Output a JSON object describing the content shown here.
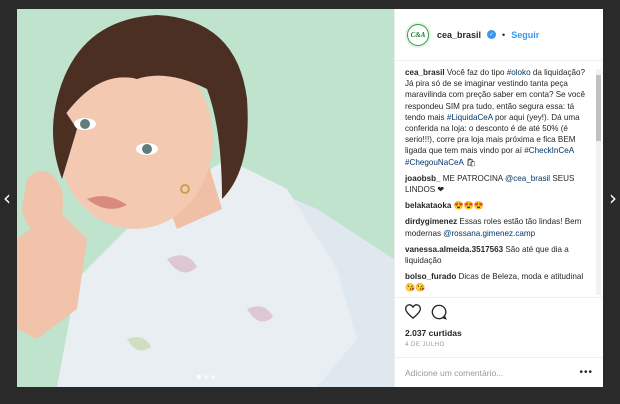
{
  "nav": {
    "prev_glyph": "‹",
    "next_glyph": "›"
  },
  "post": {
    "carousel": {
      "count": 3,
      "active": 1
    }
  },
  "header": {
    "avatar_text": "C&A",
    "username": "cea_brasil",
    "separator": "•",
    "follow_label": "Seguir"
  },
  "comments": [
    {
      "user": "cea_brasil",
      "parts": [
        {
          "t": " Você faz do tipo "
        },
        {
          "t": "#oloko",
          "tag": true
        },
        {
          "t": " da liquidação? Já pira só de se imaginar vestindo tanta peça maravilinda com preção saber em conta? Se você respondeu SIM pra tudo, então segura essa: tá tendo mais "
        },
        {
          "t": "#LiquidaCeA",
          "tag": true
        },
        {
          "t": " por aqui (yey!). Dá uma conferida na loja: o desconto é de até 50% (é serio!!!), corre pra loja mais próxima e fica BEM ligada que tem mais vindo por aí "
        },
        {
          "t": "#CheckInCeA",
          "tag": true
        },
        {
          "t": " "
        },
        {
          "t": "#ChegouNaCeA",
          "tag": true
        },
        {
          "t": " 🛍"
        }
      ]
    },
    {
      "user": "joaobsb_",
      "parts": [
        {
          "t": " ME PATROCINA "
        },
        {
          "t": "@cea_brasil",
          "tag": true
        },
        {
          "t": " SEUS LINDOS ❤"
        }
      ]
    },
    {
      "user": "belakataoka",
      "parts": [
        {
          "t": " 😍😍😍"
        }
      ]
    },
    {
      "user": "dirdygimenez",
      "parts": [
        {
          "t": " Essas roles estão tão lindas! Bem modernas "
        },
        {
          "t": "@rossana.gimenez.camp",
          "tag": true
        }
      ]
    },
    {
      "user": "vanessa.almeida.3517563",
      "parts": [
        {
          "t": " São até que dia a liquidação"
        }
      ]
    },
    {
      "user": "bolso_furado",
      "parts": [
        {
          "t": " Dicas de Beleza, moda e atitudinal 😘😘"
        }
      ]
    }
  ],
  "actions": {
    "like_icon": "heart-outline",
    "comment_icon": "speech-bubble",
    "likes_count": "2.037",
    "likes_label": "curtidas",
    "date": "4 DE JULHO"
  },
  "add_comment": {
    "placeholder": "Adicione um comentário...",
    "more_glyph": "•••"
  },
  "colors": {
    "backdrop": "#2a2a2a",
    "photo_bg": "#bfe3cc",
    "link": "#3897f0",
    "hashtag": "#003569",
    "brand_green": "#2ea043"
  }
}
